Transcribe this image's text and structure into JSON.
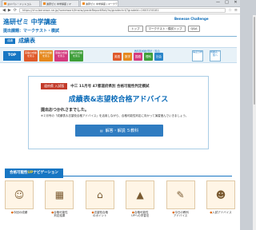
{
  "browser": {
    "tabs": [
      {
        "label": "ヨドバシ・ドットコム",
        "active": false
      },
      {
        "label": "進研ゼミ 中学講座 | マ",
        "active": false
      },
      {
        "label": "進研ゼミ 中学講座 | マークテ",
        "active": true
      }
    ],
    "url": "https://chu.benesse.ne.jp/homework/fmsiw/gradeReportMail/hs/gradechrt/?gradeId=2603150181",
    "window_buttons": [
      "—",
      "□",
      "✕"
    ]
  },
  "header": {
    "brand": "進研ゼミ 中学講座",
    "course": "提出課題：マークテスト・模試",
    "logos": "Benesse Challenge",
    "buttons": [
      "トップ",
      "マークテスト・模試トップ",
      "Q&A"
    ]
  },
  "grade_report": {
    "tag": "成績",
    "title": "成績表"
  },
  "subnav": {
    "top": "TOP",
    "blocks": [
      "英語の成績を見る",
      "数学の成績を見る",
      "国語の成績を見る",
      "理科の成績を見る"
    ],
    "subjects": [
      "英語",
      "数学",
      "国語",
      "理科",
      "社会"
    ],
    "small": "教科別成績(現状・弱点)",
    "right": [
      "得点分布",
      "成績表一覧へ"
    ]
  },
  "card": {
    "badge": "道府県 入試版",
    "exam": "中三 11月号 47都道府県別 合格可能性判定模試",
    "title": "成績表&志望校合格アドバイス",
    "greeting": "提出おつかれさまでした。",
    "note": "※２月号の「成績表＆志望校合格アドバイス」を活用しながら、合格可能性判定に向かって演習進んでいきましょう。",
    "answer_button": "解答・解説 ５教科"
  },
  "navigation": {
    "prefix": "合格可能性",
    "highlight": "UP",
    "suffix": "ナビゲーション",
    "tiles": [
      "今回の成績",
      "合格可能性\n判定結果",
      "志望校合格\nのポイント",
      "合格可能性\nUPへの学習法",
      "今日の教科\nアドバイス",
      "入試アドバイス"
    ]
  }
}
